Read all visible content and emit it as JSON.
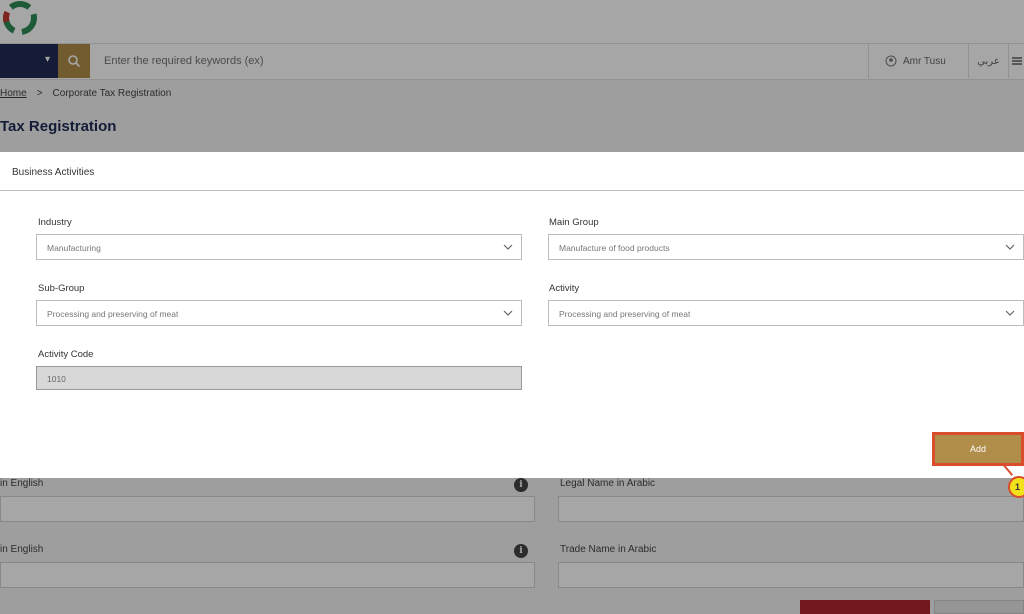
{
  "header": {
    "search_placeholder": "Enter the required keywords (ex)",
    "user_name": "Amr Tusu",
    "language_label": "عربي"
  },
  "breadcrumb": {
    "home": "Home",
    "separator": ">",
    "current": "Corporate Tax Registration"
  },
  "page": {
    "title": "Tax Registration"
  },
  "background_form": {
    "label_1": "in English",
    "label_2": "Legal Name in Arabic",
    "label_3": "in English",
    "label_4": "Trade Name in Arabic"
  },
  "modal": {
    "title": "Business Activities",
    "industry_label": "Industry",
    "industry_value": "Manufacturing",
    "main_group_label": "Main Group",
    "main_group_value": "Manufacture of food products",
    "sub_group_label": "Sub-Group",
    "sub_group_value": "Processing and preserving of meat",
    "activity_label": "Activity",
    "activity_value": "Processing and preserving of meat",
    "activity_code_label": "Activity Code",
    "activity_code_value": "1010",
    "add_button": "Add"
  },
  "annotation": {
    "marker": "1"
  },
  "colors": {
    "navy": "#1f2b55",
    "gold": "#b08d49",
    "highlight_border": "#d94d2d",
    "marker_yellow": "#f3e21b",
    "red_button": "#b3262e"
  }
}
